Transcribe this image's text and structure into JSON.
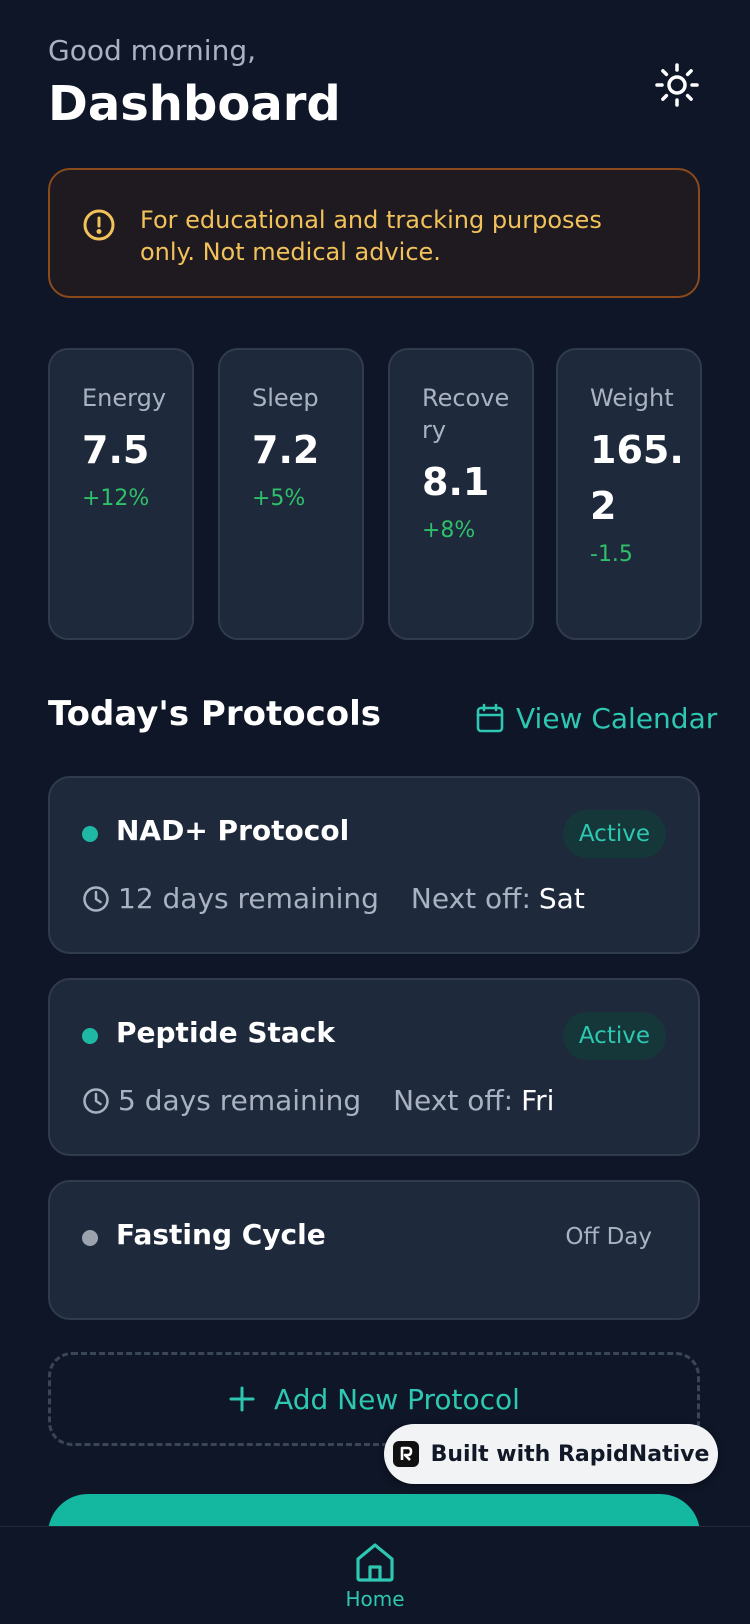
{
  "header": {
    "greeting": "Good morning,",
    "title": "Dashboard"
  },
  "disclaimer": {
    "text": "For educational and tracking purposes only. Not medical advice."
  },
  "stats": [
    {
      "label": "Energy",
      "value": "7.5",
      "change": "+12%"
    },
    {
      "label": "Sleep",
      "value": "7.2",
      "change": "+5%"
    },
    {
      "label": "Recovery",
      "value": "8.1",
      "change": "+8%"
    },
    {
      "label": "Weight",
      "value": "165.2",
      "change": "-1.5"
    }
  ],
  "protocols_section": {
    "title": "Today's Protocols",
    "view_calendar": "View Calendar"
  },
  "protocols": [
    {
      "name": "NAD+ Protocol",
      "status": "Active",
      "remaining": "12 days remaining",
      "next_off_label": "Next off:",
      "next_off": "Sat",
      "dot_color": "#1fb8a4"
    },
    {
      "name": "Peptide Stack",
      "status": "Active",
      "remaining": "5 days remaining",
      "next_off_label": "Next off:",
      "next_off": "Fri",
      "dot_color": "#1fb8a4"
    },
    {
      "name": "Fasting Cycle",
      "status": "Off Day",
      "dot_color": "#9ca3af"
    }
  ],
  "add_protocol": {
    "label": "Add New Protocol"
  },
  "built_with": {
    "label": "Built with RapidNative"
  },
  "tab_bar": {
    "home_label": "Home"
  },
  "colors": {
    "background": "#0e1627",
    "card": "#1e293b",
    "accent": "#2ec7b1",
    "positive": "#2fc06a",
    "warning": "#f2c25a"
  },
  "icons": {
    "theme_toggle": "sun-icon",
    "disclaimer": "alert-circle-icon",
    "calendar": "calendar-icon",
    "clock": "clock-icon",
    "add": "plus-icon",
    "home": "home-icon"
  }
}
